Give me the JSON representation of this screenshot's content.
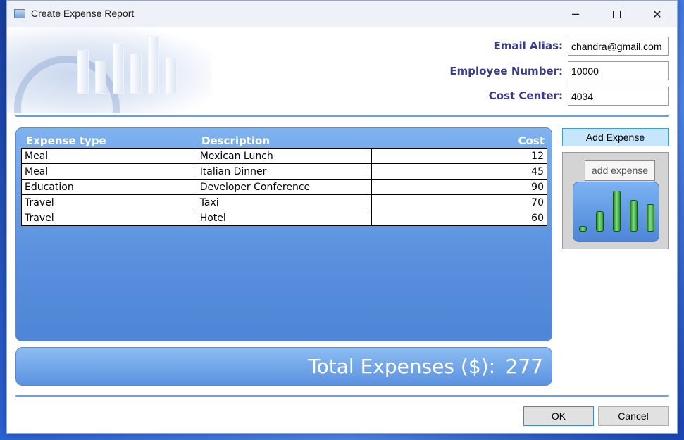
{
  "window": {
    "title": "Create Expense Report"
  },
  "titlebar_controls": {
    "minimize": "─",
    "close": "✕"
  },
  "form": {
    "email_label": "Email Alias:",
    "email_value": "chandra@gmail.com",
    "employee_label": "Employee Number:",
    "employee_value": "10000",
    "cost_center_label": "Cost Center:",
    "cost_center_value": "4034"
  },
  "grid": {
    "columns": [
      "Expense type",
      "Description",
      "Cost"
    ],
    "rows": [
      {
        "type": "Meal",
        "description": "Mexican Lunch",
        "cost": "12"
      },
      {
        "type": "Meal",
        "description": "Italian Dinner",
        "cost": "45"
      },
      {
        "type": "Education",
        "description": "Developer Conference",
        "cost": "90"
      },
      {
        "type": "Travel",
        "description": "Taxi",
        "cost": "70"
      },
      {
        "type": "Travel",
        "description": "Hotel",
        "cost": "60"
      }
    ]
  },
  "total": {
    "label": "Total Expenses ($):",
    "value": "277"
  },
  "add_expense": {
    "label": "Add Expense",
    "tooltip": "add expense"
  },
  "mini_chart": {
    "type": "bar",
    "values": [
      12,
      45,
      90,
      70,
      60
    ]
  },
  "buttons": {
    "ok": "OK",
    "cancel": "Cancel"
  },
  "colors": {
    "accent": "#6a9ee0",
    "panel_blue": "#5a90de",
    "label_text": "#3b3b8a",
    "bar_green": "#2b9a30"
  }
}
